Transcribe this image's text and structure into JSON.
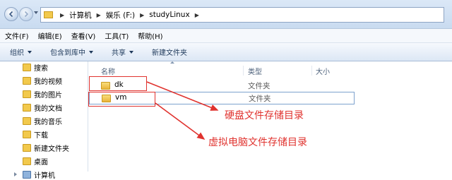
{
  "address": {
    "crumbs": [
      "计算机",
      "娱乐 (F:)",
      "studyLinux"
    ]
  },
  "menu": [
    "文件(F)",
    "编辑(E)",
    "查看(V)",
    "工具(T)",
    "帮助(H)"
  ],
  "commands": [
    {
      "label": "组织",
      "dropdown": true
    },
    {
      "label": "包含到库中",
      "dropdown": true
    },
    {
      "label": "共享",
      "dropdown": true
    },
    {
      "label": "新建文件夹",
      "dropdown": false
    }
  ],
  "nav_pane": {
    "items": [
      "搜索",
      "我的视频",
      "我的图片",
      "我的文档",
      "我的音乐",
      "下载",
      "新建文件夹",
      "桌面",
      "计算机"
    ]
  },
  "columns": {
    "name": "名称",
    "type": "类型",
    "size": "大小"
  },
  "files": [
    {
      "name": "dk",
      "type": "文件夹"
    },
    {
      "name": "vm",
      "type": "文件夹"
    }
  ],
  "annotations": {
    "label_1": "硬盘文件存储目录",
    "label_2": "虚拟电脑文件存储目录",
    "color": "#e0332f"
  }
}
